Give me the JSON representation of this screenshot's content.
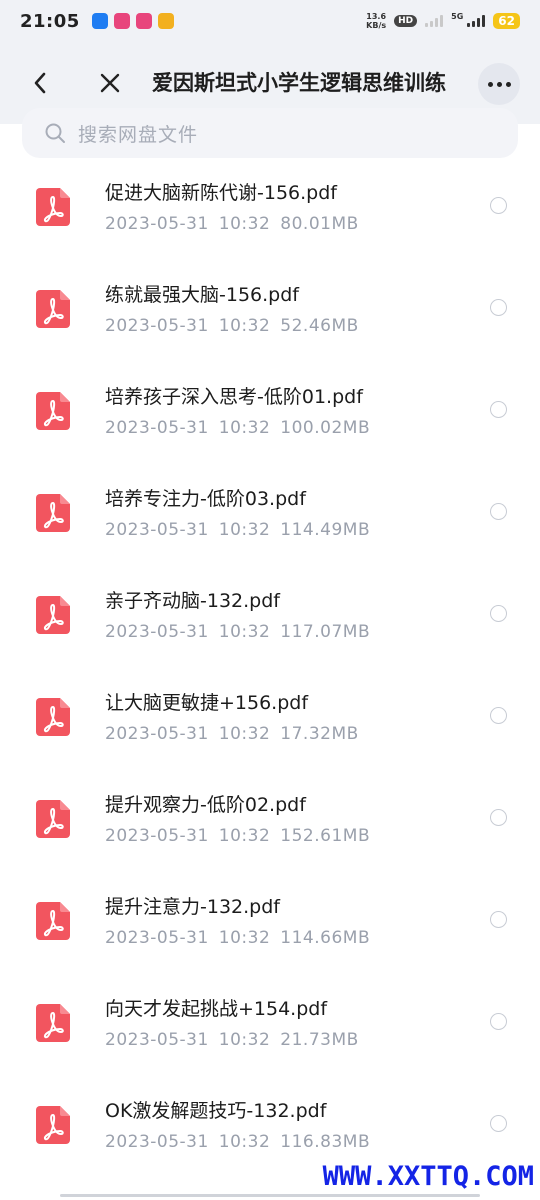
{
  "status_bar": {
    "time": "21:05",
    "net_speed_value": "13.6",
    "net_speed_unit": "KB/s",
    "hd_label": "HD",
    "signal_label": "5G",
    "battery": "62",
    "app_colors": [
      "#1f7df2",
      "#e8457c",
      "#e8457c",
      "#f2b01f"
    ]
  },
  "header": {
    "title": "爱因斯坦式小学生逻辑思维训练",
    "back_icon": "chevron-left-icon",
    "close_icon": "close-icon",
    "more_icon": "more-dots-icon"
  },
  "search": {
    "placeholder": "搜索网盘文件"
  },
  "files": [
    {
      "name": "促进大脑新陈代谢-156.pdf",
      "date": "2023-05-31",
      "time": "10:32",
      "size": "80.01MB"
    },
    {
      "name": "练就最强大脑-156.pdf",
      "date": "2023-05-31",
      "time": "10:32",
      "size": "52.46MB"
    },
    {
      "name": "培养孩子深入思考-低阶01.pdf",
      "date": "2023-05-31",
      "time": "10:32",
      "size": "100.02MB"
    },
    {
      "name": "培养专注力-低阶03.pdf",
      "date": "2023-05-31",
      "time": "10:32",
      "size": "114.49MB"
    },
    {
      "name": "亲子齐动脑-132.pdf",
      "date": "2023-05-31",
      "time": "10:32",
      "size": "117.07MB"
    },
    {
      "name": "让大脑更敏捷+156.pdf",
      "date": "2023-05-31",
      "time": "10:32",
      "size": "17.32MB"
    },
    {
      "name": "提升观察力-低阶02.pdf",
      "date": "2023-05-31",
      "time": "10:32",
      "size": "152.61MB"
    },
    {
      "name": "提升注意力-132.pdf",
      "date": "2023-05-31",
      "time": "10:32",
      "size": "114.66MB"
    },
    {
      "name": "向天才发起挑战+154.pdf",
      "date": "2023-05-31",
      "time": "10:32",
      "size": "21.73MB"
    },
    {
      "name": "OK激发解题技巧-132.pdf",
      "date": "2023-05-31",
      "time": "10:32",
      "size": "116.83MB"
    }
  ],
  "colors": {
    "pdf_icon": "#f2555f",
    "header_bg": "#f0f2f6",
    "meta_text": "#9aa0ac",
    "watermark": "#1424e6"
  },
  "watermark": "WWW.XXTTQ.COM"
}
